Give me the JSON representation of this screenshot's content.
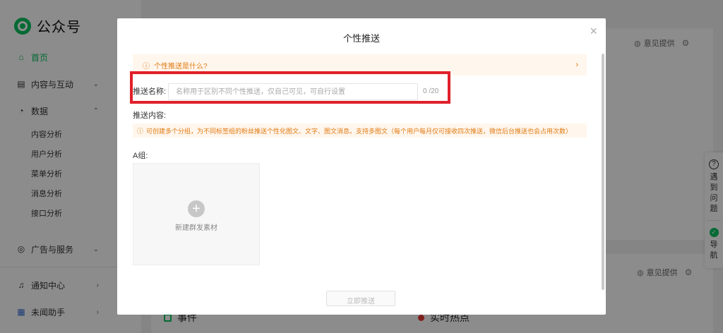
{
  "sidebar": {
    "logo": "公众号",
    "items": [
      {
        "label": "首页",
        "icon": "home-icon"
      },
      {
        "label": "内容与互动",
        "icon": "document-icon"
      },
      {
        "label": "数据",
        "icon": "chart-icon"
      },
      {
        "label": "广告与服务",
        "icon": "compass-icon"
      },
      {
        "label": "通知中心",
        "icon": "bell-icon"
      },
      {
        "label": "未闻助手",
        "icon": "assistant-icon"
      }
    ],
    "data_sub": [
      "内容分析",
      "用户分析",
      "菜单分析",
      "消息分析",
      "接口分析"
    ]
  },
  "background": {
    "feedback_label": "意见提供",
    "event_label": "事件",
    "hot_label": "实时热点"
  },
  "modal": {
    "title": "个性推送",
    "tip": "个性推送是什么?",
    "name_label": "推送名称:",
    "name_value": "",
    "name_placeholder": "名称用于区别不同个性推送，仅自己可见，可自行设置",
    "name_counter": "0 /20",
    "content_label": "推送内容:",
    "warning": "可创建多个分组，为不同标签组的粉丝推送个性化图文、文字、图文消息。支持多图文（每个用户每月仅可接收四次推送，微信后台推送也会占用次数）",
    "group_label": "A组:",
    "add_material": "新建群发素材",
    "footer_button": "立即推送"
  },
  "float_tools": {
    "help": "遇到问题",
    "nav": "导航"
  },
  "colors": {
    "accent": "#07c160",
    "warning": "#e07b12",
    "highlight": "#e0202a"
  }
}
